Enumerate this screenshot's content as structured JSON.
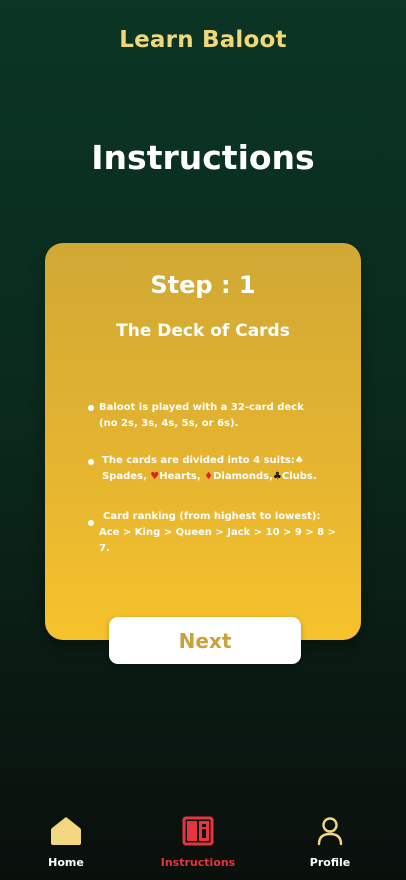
{
  "header": {
    "app_title": "Learn Baloot",
    "page_title": "Instructions"
  },
  "card": {
    "step_title": "Step : 1",
    "step_subtitle": "The Deck of Cards",
    "bullet1_line1": "Baloot is played with a 32-card deck",
    "bullet1_line2": "(no 2s, 3s, 4s, 5s, or 6s).",
    "bullet2_prefix": "The cards are divided into 4 suits:",
    "bullet2_spades": "Spades,",
    "bullet2_hearts": "Hearts,",
    "bullet2_diamonds": "Diamonds,",
    "bullet2_clubs": "Clubs.",
    "bullet3_line1": "Card ranking (from highest to lowest):",
    "bullet3_line2": "Ace > King > Queen > Jack > 10 > 9 > 8 > 7."
  },
  "actions": {
    "next_label": "Next"
  },
  "tabbar": {
    "home": "Home",
    "instructions": "Instructions",
    "profile": "Profile",
    "active_tab": "instructions"
  },
  "colors": {
    "accent": "#f0d77a",
    "card_top": "#d0a834",
    "card_bottom": "#f6c22c",
    "active_tab": "#e8343f"
  },
  "icons": {
    "home": "home-icon",
    "instructions": "book-icon",
    "profile": "user-icon",
    "spades": "spade-icon",
    "hearts": "heart-icon",
    "diamonds": "diamond-icon",
    "clubs": "club-icon"
  }
}
